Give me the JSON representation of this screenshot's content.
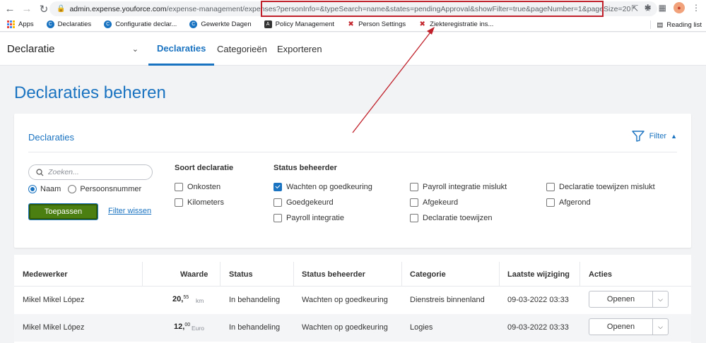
{
  "browser": {
    "url_host": "admin.expense.youforce.com",
    "url_path_a": "/expense-management/expenses",
    "url_path_b": "?personInfo=&typeSearch=name&states=pendingApproval&showFilter=true&pageNumber=1&pageSize=20",
    "bookmarks": [
      {
        "label": "Apps",
        "icon": "apps-grid-icon"
      },
      {
        "label": "Declaraties",
        "icon": "c-blue-icon",
        "color": "#1a73c0"
      },
      {
        "label": "Configuratie declar...",
        "icon": "c-blue-icon",
        "color": "#1a73c0"
      },
      {
        "label": "Gewerkte Dagen",
        "icon": "c-blue-icon",
        "color": "#1a73c0"
      },
      {
        "label": "Policy Management",
        "icon": "angular-icon",
        "color": "#333333"
      },
      {
        "label": "Person Settings",
        "icon": "visma-icon",
        "color": "#c4262e"
      },
      {
        "label": "Ziekteregistratie ins...",
        "icon": "visma-icon",
        "color": "#c4262e"
      }
    ],
    "reading_list": "Reading list"
  },
  "header": {
    "app_name": "Declaratie",
    "tabs": [
      {
        "label": "Declaraties",
        "active": true
      },
      {
        "label": "Categorieën",
        "active": false
      },
      {
        "label": "Exporteren",
        "active": false
      }
    ]
  },
  "page": {
    "title": "Declaraties beheren"
  },
  "filter": {
    "title": "Declaraties",
    "toggle_label": "Filter",
    "search_placeholder": "Zoeken...",
    "radios": [
      {
        "label": "Naam",
        "checked": true
      },
      {
        "label": "Persoonsnummer",
        "checked": false
      }
    ],
    "apply_label": "Toepassen",
    "clear_label": "Filter wissen",
    "type_title": "Soort declaratie",
    "type_options": [
      {
        "label": "Onkosten",
        "checked": false
      },
      {
        "label": "Kilometers",
        "checked": false
      }
    ],
    "status_title": "Status beheerder",
    "status_options": [
      {
        "label": "Wachten op goedkeuring",
        "checked": true
      },
      {
        "label": "Goedgekeurd",
        "checked": false
      },
      {
        "label": "Payroll integratie",
        "checked": false
      },
      {
        "label": "Payroll integratie mislukt",
        "checked": false
      },
      {
        "label": "Afgekeurd",
        "checked": false
      },
      {
        "label": "Declaratie toewijzen",
        "checked": false
      },
      {
        "label": "Declaratie toewijzen mislukt",
        "checked": false
      },
      {
        "label": "Afgerond",
        "checked": false
      }
    ]
  },
  "table": {
    "headers": [
      "Medewerker",
      "Waarde",
      "Status",
      "Status beheerder",
      "Categorie",
      "Laatste wijziging",
      "Acties"
    ],
    "rows": [
      {
        "employee": "Mikel Mikel López",
        "amount_int": "20",
        "amount_dec": "55",
        "unit": "km",
        "status": "In behandeling",
        "admin_status": "Wachten op goedkeuring",
        "category": "Dienstreis binnenland",
        "modified": "09-03-2022 03:33",
        "action": "Openen"
      },
      {
        "employee": "Mikel Mikel López",
        "amount_int": "12",
        "amount_dec": "00",
        "unit": "Euro",
        "status": "In behandeling",
        "admin_status": "Wachten op goedkeuring",
        "category": "Logies",
        "modified": "09-03-2022 03:33",
        "action": "Openen"
      }
    ]
  },
  "colors": {
    "accent": "#1a73c0",
    "apply": "#4b7f12",
    "annotation": "#c0202a"
  }
}
